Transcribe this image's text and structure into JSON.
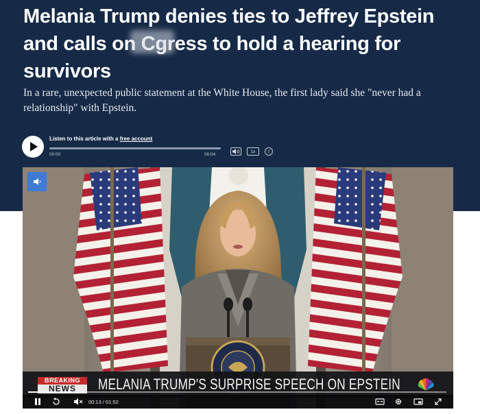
{
  "article": {
    "headline_part1": "Melania Trump denies ties to Jeffrey Epstein and calls on C",
    "headline_part2": "gress to hold a hearing for survivors",
    "dek": "In a rare, unexpected public statement at the White House, the first lady said she \"never had a relationship\" with Epstein."
  },
  "audio_player": {
    "listen_prefix": "Listen to this article with a ",
    "listen_link": "free account",
    "time_start": "00:00",
    "time_end": "06:04",
    "volume_icon": "volume-icon",
    "speed_label": "1x",
    "info_label": "i",
    "progress": 0
  },
  "video": {
    "mute_icon": "speaker-icon",
    "breaking_label": "BREAKING",
    "news_label": "NEWS",
    "ticker": "MELANIA TRUMP'S SURPRISE SPEECH ON EPSTEIN",
    "time": "00:13 / 01:52",
    "progress": 0.115,
    "controls": [
      "pause-icon",
      "replay-10-icon",
      "volume-icon",
      "captions-icon",
      "settings-icon",
      "picture-in-picture-icon",
      "fullscreen-icon"
    ]
  },
  "colors": {
    "header_bg": "#162a47",
    "mute_button": "#3f7bd4",
    "breaking_red": "#c52b2b"
  }
}
